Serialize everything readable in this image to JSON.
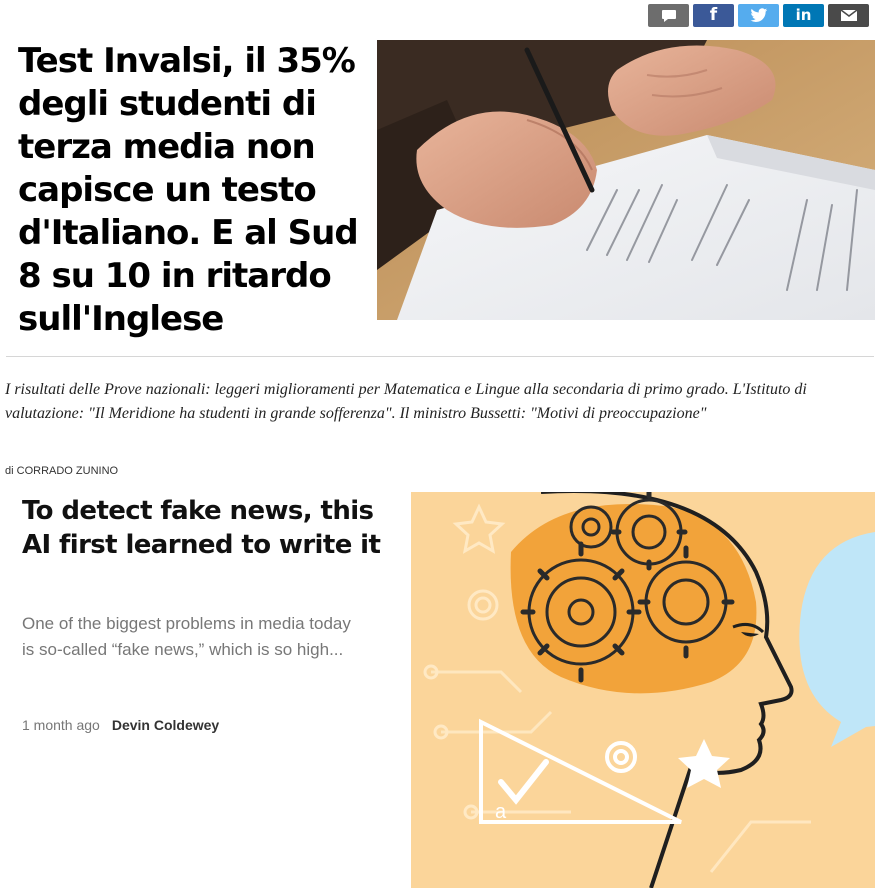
{
  "share": {
    "buttons": [
      {
        "icon": "comment-icon",
        "color": "#6d6d6d"
      },
      {
        "icon": "facebook-icon",
        "color": "#3b5998"
      },
      {
        "icon": "twitter-icon",
        "color": "#55acee"
      },
      {
        "icon": "linkedin-icon",
        "color": "#0077b5"
      },
      {
        "icon": "email-icon",
        "color": "#4a4a4a"
      }
    ],
    "facebook_glyph": "f",
    "linkedin_glyph": "in"
  },
  "article1": {
    "headline": "Test Invalsi, il 35% degli studenti di terza media non capisce un testo d'Italiano. E al Sud 8 su 10 in ritardo sull'Inglese",
    "summary": "I risultati delle Prove nazionali: leggeri miglioramenti per Matematica e Lingue alla secondaria di primo grado. L'Istituto di valutazione: \"Il Meridione ha studenti in grande sofferenza\". Il ministro Bussetti: \"Motivi di preoccupazione\"",
    "byline_prefix": "di",
    "author": "Corrado Zunino"
  },
  "article2": {
    "headline": "To detect fake news, this AI first learned to write it",
    "excerpt": "One of the biggest problems in media today is so-called “fake news,” which is so high...",
    "time": "1 month ago",
    "author": "Devin Coldewey",
    "illustration_letter": "a"
  },
  "colors": {
    "illustration_bg": "#fbd59a",
    "illustration_orange": "#f2a33a",
    "speech_bubble": "#bfe6f8"
  }
}
